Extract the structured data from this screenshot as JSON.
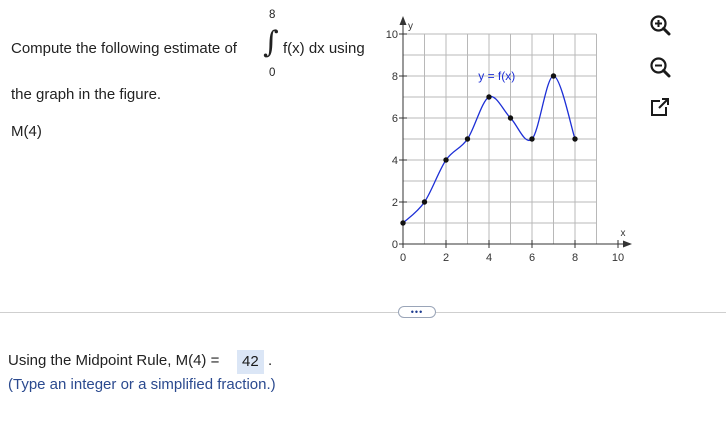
{
  "question": {
    "prefix": "Compute the following estimate of",
    "integral_upper": "8",
    "integral_lower": "0",
    "integrand": "f(x) dx using",
    "line2": "the graph in the figure.",
    "estimate_label": "M(4)"
  },
  "more_button": {
    "label": "•••"
  },
  "answer": {
    "prefix": "Using the Midpoint Rule, M(4) =",
    "value": "42",
    "suffix": ".",
    "hint": "(Type an integer or a simplified fraction.)"
  },
  "tools": {
    "zoom_in_icon": "zoom-in-icon",
    "zoom_out_icon": "zoom-out-icon",
    "popout_icon": "popout-icon"
  },
  "colors": {
    "curve": "#1d2fd6",
    "answer_bg": "#dbe6f6",
    "hint": "#2b4a8f"
  },
  "chart_data": {
    "type": "line",
    "xlabel": "x",
    "ylabel": "y",
    "curve_label": "y = f(x)",
    "xlim": [
      0,
      10
    ],
    "ylim": [
      0,
      10
    ],
    "grid": true,
    "x_ticks": [
      0,
      2,
      4,
      6,
      8,
      10
    ],
    "y_ticks": [
      0,
      2,
      4,
      6,
      8,
      10
    ],
    "points": [
      [
        0,
        1
      ],
      [
        1,
        2
      ],
      [
        2,
        4
      ],
      [
        3,
        5
      ],
      [
        4,
        7
      ],
      [
        5,
        6
      ],
      [
        6,
        5
      ],
      [
        7,
        8
      ],
      [
        8,
        5
      ]
    ]
  }
}
